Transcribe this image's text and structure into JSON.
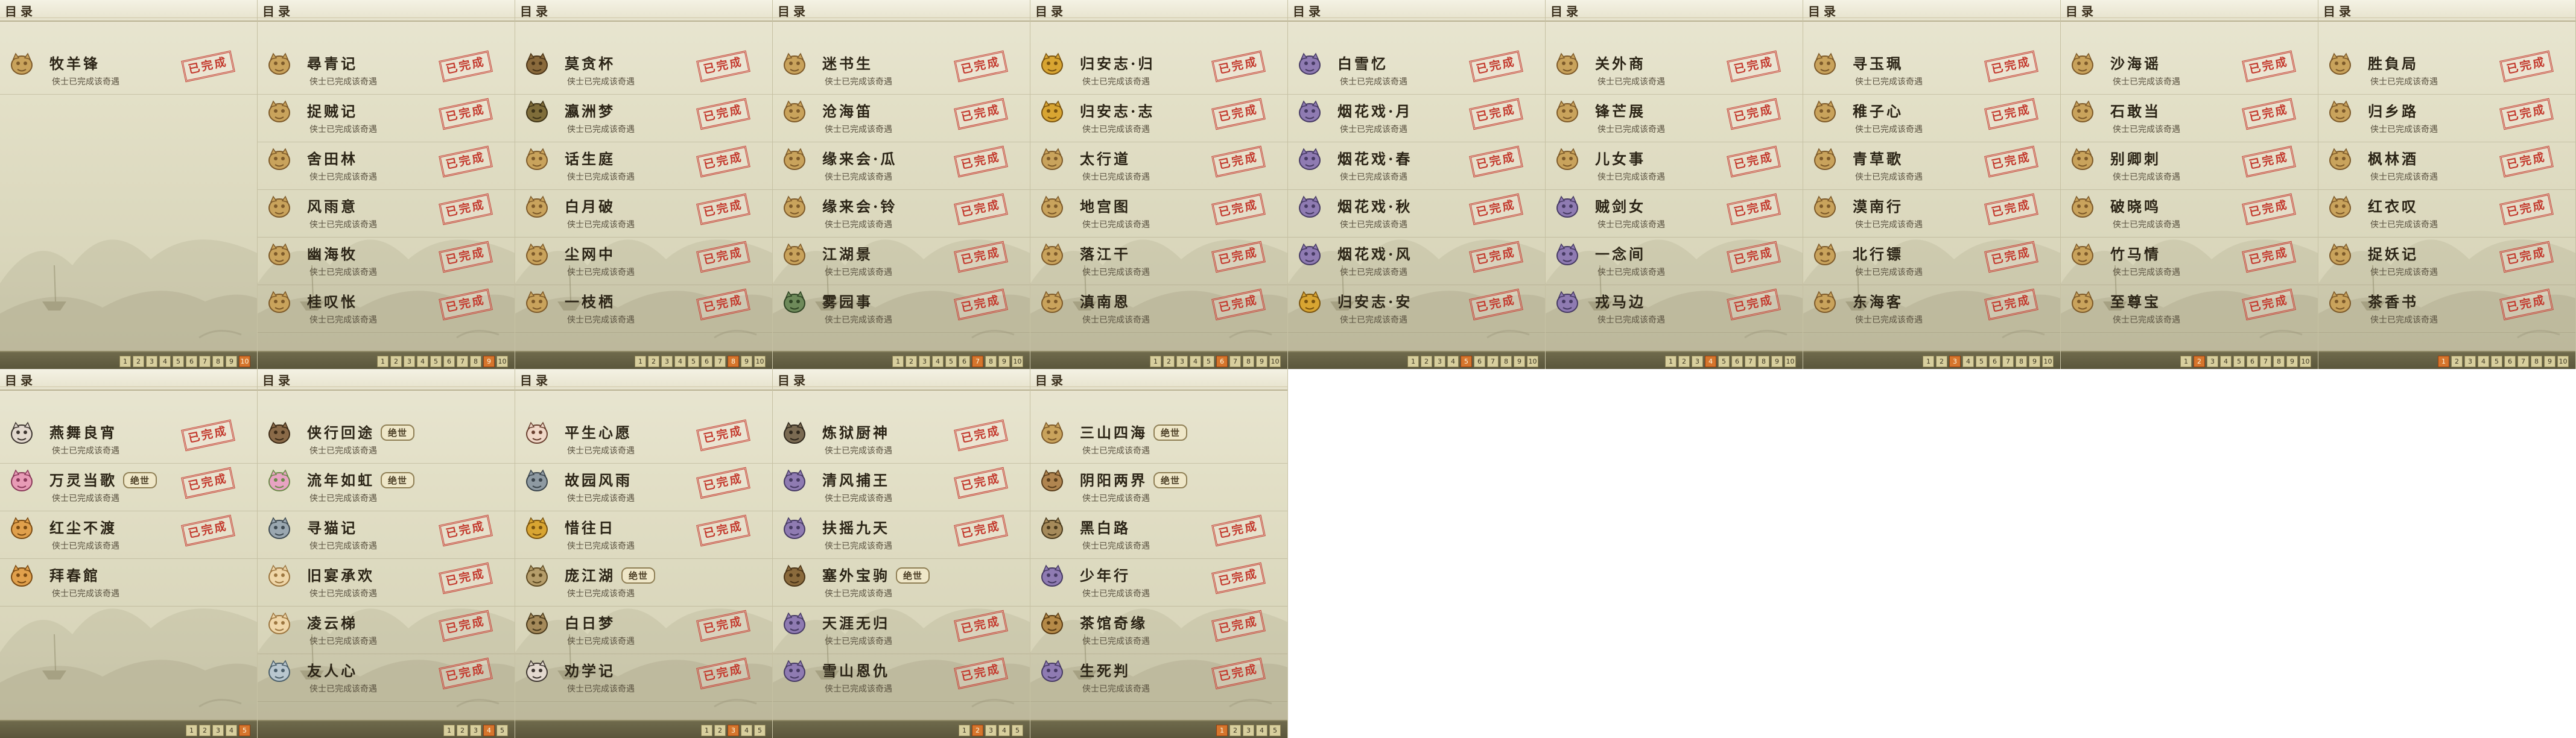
{
  "colors": {
    "stamp_red": "#c33a2e",
    "pager_active": "#d6752c",
    "panel_bg": "#e2dfc6"
  },
  "panels": [
    {
      "header": "目录",
      "total_pages": 10,
      "active_page": 10,
      "entries": [
        {
          "name": "牧羊锋",
          "desc": "侠士已完成该奇遇",
          "stamp": "已完成",
          "tag": "",
          "icon": "dog-icon"
        }
      ]
    },
    {
      "header": "目录",
      "total_pages": 10,
      "active_page": 9,
      "entries": [
        {
          "name": "尋青记",
          "desc": "侠士已完成该奇遇",
          "stamp": "已完成",
          "tag": "",
          "icon": "dog-icon"
        },
        {
          "name": "捉贼记",
          "desc": "侠士已完成该奇遇",
          "stamp": "已完成",
          "tag": "",
          "icon": "dog-icon"
        },
        {
          "name": "舍田林",
          "desc": "侠士已完成该奇遇",
          "stamp": "已完成",
          "tag": "",
          "icon": "dog-icon"
        },
        {
          "name": "风雨意",
          "desc": "侠士已完成该奇遇",
          "stamp": "已完成",
          "tag": "",
          "icon": "dog-icon"
        },
        {
          "name": "幽海牧",
          "desc": "侠士已完成该奇遇",
          "stamp": "已完成",
          "tag": "",
          "icon": "dog-icon"
        },
        {
          "name": "桂叹怅",
          "desc": "侠士已完成该奇遇",
          "stamp": "已完成",
          "tag": "",
          "icon": "dog-icon"
        }
      ]
    },
    {
      "header": "目录",
      "total_pages": 10,
      "active_page": 8,
      "entries": [
        {
          "name": "莫贪杯",
          "desc": "侠士已完成该奇遇",
          "stamp": "已完成",
          "tag": "",
          "icon": "horse-icon"
        },
        {
          "name": "瀛洲梦",
          "desc": "侠士已完成该奇遇",
          "stamp": "已完成",
          "tag": "",
          "icon": "turtle-icon"
        },
        {
          "name": "话生庭",
          "desc": "侠士已完成该奇遇",
          "stamp": "已完成",
          "tag": "",
          "icon": "dog-icon"
        },
        {
          "name": "白月破",
          "desc": "侠士已完成该奇遇",
          "stamp": "已完成",
          "tag": "",
          "icon": "dog-icon"
        },
        {
          "name": "尘网中",
          "desc": "侠士已完成该奇遇",
          "stamp": "已完成",
          "tag": "",
          "icon": "dog-icon"
        },
        {
          "name": "一枝栖",
          "desc": "侠士已完成该奇遇",
          "stamp": "已完成",
          "tag": "",
          "icon": "dog-icon"
        }
      ]
    },
    {
      "header": "目录",
      "total_pages": 10,
      "active_page": 7,
      "entries": [
        {
          "name": "迷书生",
          "desc": "侠士已完成该奇遇",
          "stamp": "已完成",
          "tag": "",
          "icon": "dog-icon"
        },
        {
          "name": "沧海笛",
          "desc": "侠士已完成该奇遇",
          "stamp": "已完成",
          "tag": "",
          "icon": "dog-icon"
        },
        {
          "name": "缘来会·瓜",
          "desc": "侠士已完成该奇遇",
          "stamp": "已完成",
          "tag": "",
          "icon": "dog-icon"
        },
        {
          "name": "缘来会·铃",
          "desc": "侠士已完成该奇遇",
          "stamp": "已完成",
          "tag": "",
          "icon": "dog-icon"
        },
        {
          "name": "江湖景",
          "desc": "侠士已完成该奇遇",
          "stamp": "已完成",
          "tag": "",
          "icon": "dog-icon"
        },
        {
          "name": "雾园事",
          "desc": "侠士已完成该奇遇",
          "stamp": "已完成",
          "tag": "",
          "icon": "dragon-icon"
        }
      ]
    },
    {
      "header": "目录",
      "total_pages": 10,
      "active_page": 6,
      "entries": [
        {
          "name": "归安志·归",
          "desc": "侠士已完成该奇遇",
          "stamp": "已完成",
          "tag": "",
          "icon": "lamp-icon"
        },
        {
          "name": "归安志·志",
          "desc": "侠士已完成该奇遇",
          "stamp": "已完成",
          "tag": "",
          "icon": "lamp-icon"
        },
        {
          "name": "太行道",
          "desc": "侠士已完成该奇遇",
          "stamp": "已完成",
          "tag": "",
          "icon": "dog-icon"
        },
        {
          "name": "地宫图",
          "desc": "侠士已完成该奇遇",
          "stamp": "已完成",
          "tag": "",
          "icon": "dog-icon"
        },
        {
          "name": "落江干",
          "desc": "侠士已完成该奇遇",
          "stamp": "已完成",
          "tag": "",
          "icon": "dog-icon"
        },
        {
          "name": "滇南恩",
          "desc": "侠士已完成该奇遇",
          "stamp": "已完成",
          "tag": "",
          "icon": "dog-icon"
        }
      ]
    },
    {
      "header": "目录",
      "total_pages": 10,
      "active_page": 5,
      "entries": [
        {
          "name": "白雪忆",
          "desc": "侠士已完成该奇遇",
          "stamp": "已完成",
          "tag": "",
          "icon": "figure-icon"
        },
        {
          "name": "烟花戏·月",
          "desc": "侠士已完成该奇遇",
          "stamp": "已完成",
          "tag": "",
          "icon": "figure-icon"
        },
        {
          "name": "烟花戏·春",
          "desc": "侠士已完成该奇遇",
          "stamp": "已完成",
          "tag": "",
          "icon": "figure-icon"
        },
        {
          "name": "烟花戏·秋",
          "desc": "侠士已完成该奇遇",
          "stamp": "已完成",
          "tag": "",
          "icon": "figure-icon"
        },
        {
          "name": "烟花戏·风",
          "desc": "侠士已完成该奇遇",
          "stamp": "已完成",
          "tag": "",
          "icon": "figure-icon"
        },
        {
          "name": "归安志·安",
          "desc": "侠士已完成该奇遇",
          "stamp": "已完成",
          "tag": "",
          "icon": "lamp-icon"
        }
      ]
    },
    {
      "header": "目录",
      "total_pages": 10,
      "active_page": 4,
      "entries": [
        {
          "name": "关外商",
          "desc": "侠士已完成该奇遇",
          "stamp": "已完成",
          "tag": "",
          "icon": "dog-icon"
        },
        {
          "name": "锋芒展",
          "desc": "侠士已完成该奇遇",
          "stamp": "已完成",
          "tag": "",
          "icon": "dog-icon"
        },
        {
          "name": "儿女事",
          "desc": "侠士已完成该奇遇",
          "stamp": "已完成",
          "tag": "",
          "icon": "dog-icon"
        },
        {
          "name": "贼剑女",
          "desc": "侠士已完成该奇遇",
          "stamp": "已完成",
          "tag": "",
          "icon": "figure-icon"
        },
        {
          "name": "一念间",
          "desc": "侠士已完成该奇遇",
          "stamp": "已完成",
          "tag": "",
          "icon": "figure-icon"
        },
        {
          "name": "戎马边",
          "desc": "侠士已完成该奇遇",
          "stamp": "已完成",
          "tag": "",
          "icon": "figure-icon"
        }
      ]
    },
    {
      "header": "目录",
      "total_pages": 10,
      "active_page": 3,
      "entries": [
        {
          "name": "寻玉珮",
          "desc": "侠士已完成该奇遇",
          "stamp": "已完成",
          "tag": "",
          "icon": "dog-icon"
        },
        {
          "name": "稚子心",
          "desc": "侠士已完成该奇遇",
          "stamp": "已完成",
          "tag": "",
          "icon": "dog-icon"
        },
        {
          "name": "青草歌",
          "desc": "侠士已完成该奇遇",
          "stamp": "已完成",
          "tag": "",
          "icon": "dog-icon"
        },
        {
          "name": "漠南行",
          "desc": "侠士已完成该奇遇",
          "stamp": "已完成",
          "tag": "",
          "icon": "dog-icon"
        },
        {
          "name": "北行镖",
          "desc": "侠士已完成该奇遇",
          "stamp": "已完成",
          "tag": "",
          "icon": "dog-icon"
        },
        {
          "name": "东海客",
          "desc": "侠士已完成该奇遇",
          "stamp": "已完成",
          "tag": "",
          "icon": "dog-icon"
        }
      ]
    },
    {
      "header": "目录",
      "total_pages": 10,
      "active_page": 2,
      "entries": [
        {
          "name": "沙海谣",
          "desc": "侠士已完成该奇遇",
          "stamp": "已完成",
          "tag": "",
          "icon": "dog-icon"
        },
        {
          "name": "石敢当",
          "desc": "侠士已完成该奇遇",
          "stamp": "已完成",
          "tag": "",
          "icon": "dog-icon"
        },
        {
          "name": "别卿刺",
          "desc": "侠士已完成该奇遇",
          "stamp": "已完成",
          "tag": "",
          "icon": "dog-icon"
        },
        {
          "name": "破晓鸣",
          "desc": "侠士已完成该奇遇",
          "stamp": "已完成",
          "tag": "",
          "icon": "dog-icon"
        },
        {
          "name": "竹马情",
          "desc": "侠士已完成该奇遇",
          "stamp": "已完成",
          "tag": "",
          "icon": "dog-icon"
        },
        {
          "name": "至尊宝",
          "desc": "侠士已完成该奇遇",
          "stamp": "已完成",
          "tag": "",
          "icon": "dog-icon"
        }
      ]
    },
    {
      "header": "目录",
      "total_pages": 10,
      "active_page": 1,
      "entries": [
        {
          "name": "胜負局",
          "desc": "侠士已完成该奇遇",
          "stamp": "已完成",
          "tag": "",
          "icon": "dog-icon"
        },
        {
          "name": "归乡路",
          "desc": "侠士已完成该奇遇",
          "stamp": "已完成",
          "tag": "",
          "icon": "dog-icon"
        },
        {
          "name": "枫林酒",
          "desc": "侠士已完成该奇遇",
          "stamp": "已完成",
          "tag": "",
          "icon": "dog-icon"
        },
        {
          "name": "红衣叹",
          "desc": "侠士已完成该奇遇",
          "stamp": "已完成",
          "tag": "",
          "icon": "dog-icon"
        },
        {
          "name": "捉妖记",
          "desc": "侠士已完成该奇遇",
          "stamp": "已完成",
          "tag": "",
          "icon": "dog-icon"
        },
        {
          "name": "茶香书",
          "desc": "侠士已完成该奇遇",
          "stamp": "已完成",
          "tag": "",
          "icon": "dog-icon"
        }
      ]
    },
    {
      "header": "目录",
      "total_pages": 5,
      "active_page": 5,
      "entries": [
        {
          "name": "燕舞良宵",
          "desc": "侠士已完成该奇遇",
          "stamp": "已完成",
          "tag": "",
          "icon": "panda-icon"
        },
        {
          "name": "万灵当歌",
          "desc": "侠士已完成该奇遇",
          "stamp": "已完成",
          "tag": "绝世",
          "icon": "flower-icon"
        },
        {
          "name": "红尘不渡",
          "desc": "侠士已完成该奇遇",
          "stamp": "已完成",
          "tag": "",
          "icon": "fox-icon"
        },
        {
          "name": "拜春館",
          "desc": "侠士已完成该奇遇",
          "stamp": "",
          "tag": "",
          "icon": "fox-icon"
        }
      ]
    },
    {
      "header": "目录",
      "total_pages": 5,
      "active_page": 4,
      "entries": [
        {
          "name": "侠行回途",
          "desc": "侠士已完成该奇遇",
          "stamp": "",
          "tag": "绝世",
          "icon": "hat-icon"
        },
        {
          "name": "流年如虹",
          "desc": "侠士已完成该奇遇",
          "stamp": "",
          "tag": "绝世",
          "icon": "lotus-icon"
        },
        {
          "name": "寻猫记",
          "desc": "侠士已完成该奇遇",
          "stamp": "已完成",
          "tag": "",
          "icon": "cat-icon"
        },
        {
          "name": "旧宴承欢",
          "desc": "侠士已完成该奇遇",
          "stamp": "已完成",
          "tag": "",
          "icon": "bun-icon"
        },
        {
          "name": "凌云梯",
          "desc": "侠士已完成该奇遇",
          "stamp": "已完成",
          "tag": "",
          "icon": "bun-icon"
        },
        {
          "name": "友人心",
          "desc": "侠士已完成该奇遇",
          "stamp": "已完成",
          "tag": "",
          "icon": "bird-icon"
        }
      ]
    },
    {
      "header": "目录",
      "total_pages": 5,
      "active_page": 3,
      "entries": [
        {
          "name": "平生心愿",
          "desc": "侠士已完成该奇遇",
          "stamp": "已完成",
          "tag": "",
          "icon": "face-icon"
        },
        {
          "name": "故园风雨",
          "desc": "侠士已完成该奇遇",
          "stamp": "已完成",
          "tag": "",
          "icon": "armor-icon"
        },
        {
          "name": "惜往日",
          "desc": "侠士已完成该奇遇",
          "stamp": "已完成",
          "tag": "",
          "icon": "lamp-icon"
        },
        {
          "name": "庞江湖",
          "desc": "侠士已完成该奇遇",
          "stamp": "",
          "tag": "绝世",
          "icon": "scroll-icon"
        },
        {
          "name": "白日梦",
          "desc": "侠士已完成该奇遇",
          "stamp": "已完成",
          "tag": "",
          "icon": "book-icon"
        },
        {
          "name": "劝学记",
          "desc": "侠士已完成该奇遇",
          "stamp": "已完成",
          "tag": "",
          "icon": "panda-icon"
        }
      ]
    },
    {
      "header": "目录",
      "total_pages": 5,
      "active_page": 2,
      "entries": [
        {
          "name": "炼狱厨神",
          "desc": "侠士已完成该奇遇",
          "stamp": "已完成",
          "tag": "",
          "icon": "pot-icon"
        },
        {
          "name": "清风捕王",
          "desc": "侠士已完成该奇遇",
          "stamp": "已完成",
          "tag": "",
          "icon": "figure-icon"
        },
        {
          "name": "扶摇九天",
          "desc": "侠士已完成该奇遇",
          "stamp": "已完成",
          "tag": "",
          "icon": "figure-icon"
        },
        {
          "name": "塞外宝驹",
          "desc": "侠士已完成该奇遇",
          "stamp": "",
          "tag": "绝世",
          "icon": "horse-icon"
        },
        {
          "name": "天涯无归",
          "desc": "侠士已完成该奇遇",
          "stamp": "已完成",
          "tag": "",
          "icon": "figure-icon"
        },
        {
          "name": "雪山恩仇",
          "desc": "侠士已完成该奇遇",
          "stamp": "已完成",
          "tag": "",
          "icon": "figure-icon"
        }
      ]
    },
    {
      "header": "目录",
      "total_pages": 5,
      "active_page": 1,
      "entries": [
        {
          "name": "三山四海",
          "desc": "侠士已完成该奇遇",
          "stamp": "",
          "tag": "绝世",
          "icon": "dog-icon"
        },
        {
          "name": "阴阳两界",
          "desc": "侠士已完成该奇遇",
          "stamp": "",
          "tag": "绝世",
          "icon": "monkey-icon"
        },
        {
          "name": "黑白路",
          "desc": "侠士已完成该奇遇",
          "stamp": "已完成",
          "tag": "",
          "icon": "book-icon"
        },
        {
          "name": "少年行",
          "desc": "侠士已完成该奇遇",
          "stamp": "已完成",
          "tag": "",
          "icon": "figure-icon"
        },
        {
          "name": "茶馆奇缘",
          "desc": "侠士已完成该奇遇",
          "stamp": "已完成",
          "tag": "",
          "icon": "chest-icon"
        },
        {
          "name": "生死判",
          "desc": "侠士已完成该奇遇",
          "stamp": "已完成",
          "tag": "",
          "icon": "figure-icon"
        }
      ]
    }
  ]
}
